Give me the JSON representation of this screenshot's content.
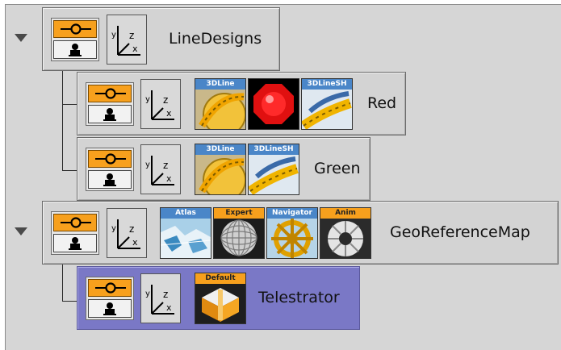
{
  "tree": {
    "nodes": [
      {
        "id": "linedesigns",
        "label": "LineDesigns",
        "plugins": []
      },
      {
        "id": "red",
        "label": "Red",
        "plugins": [
          "3DLine",
          "",
          "3DLineSH"
        ]
      },
      {
        "id": "green",
        "label": "Green",
        "plugins": [
          "3DLine",
          "3DLineSH"
        ]
      },
      {
        "id": "georeferencemap",
        "label": "GeoReferenceMap",
        "plugins": [
          "Atlas",
          "Expert",
          "Navigator",
          "Anim"
        ]
      },
      {
        "id": "telestrator",
        "label": "Telestrator",
        "plugins": [
          "Default"
        ]
      }
    ]
  },
  "colors": {
    "panel": "#d3d3d3",
    "selected": "#7a78c6",
    "accent_orange": "#f7a01d",
    "tag_blue": "#4a86c8"
  }
}
